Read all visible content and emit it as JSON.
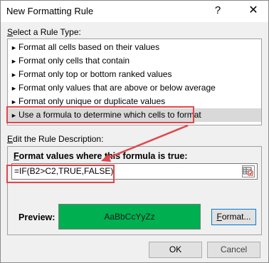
{
  "window": {
    "title": "New Formatting Rule",
    "help_glyph": "?",
    "close_glyph": "✕"
  },
  "rule_type": {
    "label_prefix": "S",
    "label_rest": "elect a Rule Type:",
    "arrow_glyph": "►",
    "items": [
      {
        "label": "Format all cells based on their values"
      },
      {
        "label": "Format only cells that contain"
      },
      {
        "label": "Format only top or bottom ranked values"
      },
      {
        "label": "Format only values that are above or below average"
      },
      {
        "label": "Format only unique or duplicate values"
      },
      {
        "label": "Use a formula to determine which cells to format",
        "selected": true
      }
    ]
  },
  "description": {
    "label_prefix": "E",
    "label_rest": "dit the Rule Description:",
    "formula_label_prefix": "F",
    "formula_label_rest": "ormat values where this formula is true:",
    "formula_value": "=IF(B2>C2,TRUE,FALSE)"
  },
  "preview": {
    "label": "Preview:",
    "sample_text": "AaBbCcYyZz",
    "fill_color": "#00b050"
  },
  "buttons": {
    "format_prefix": "F",
    "format_rest": "ormat...",
    "ok": "OK",
    "cancel": "Cancel"
  },
  "annotation": {
    "color": "#e0474c"
  }
}
